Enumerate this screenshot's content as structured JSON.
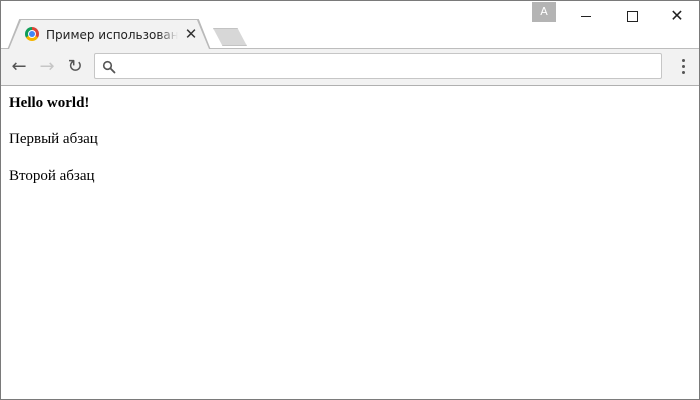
{
  "window": {
    "tab": {
      "title": "Пример использования",
      "close_glyph": "✕",
      "favicon": "chrome-favicon-icon"
    },
    "profile_badge": "A",
    "controls": {
      "minimize": "minimize-icon",
      "maximize": "maximize-icon",
      "close": "✕"
    }
  },
  "toolbar": {
    "back": "←",
    "forward": "→",
    "reload": "↻",
    "address": {
      "value": "",
      "placeholder": ""
    },
    "menu": "more-vertical-icon"
  },
  "page": {
    "heading": "Hello world!",
    "paragraphs": [
      "Первый абзац",
      "Второй абзац"
    ]
  }
}
